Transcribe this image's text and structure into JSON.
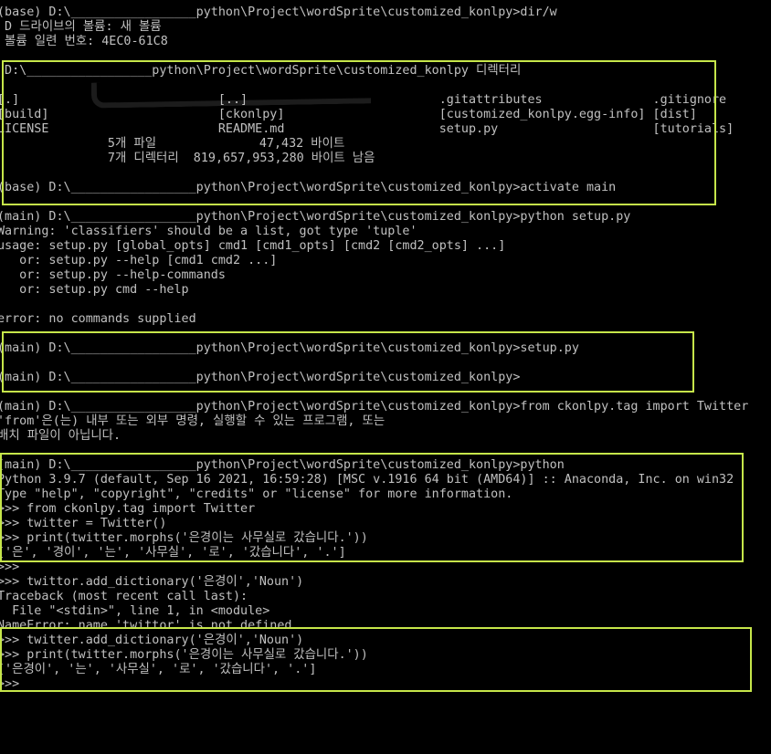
{
  "lines": [
    "(base) D:\\_________________python\\Project\\wordSprite\\customized_konlpy>dir/w",
    " D 드라이브의 볼륨: 새 볼륨",
    " 볼륨 일련 번호: 4EC0-61C8",
    "",
    " D:\\_________________python\\Project\\wordSprite\\customized_konlpy 디렉터리",
    "",
    "[.]                           [..]                          .gitattributes               .gitignore",
    "[build]                       [ckonlpy]                     [customized_konlpy.egg-info] [dist]",
    "LICENSE                       README.md                     setup.py                     [tutorials]",
    "               5개 파일              47,432 바이트",
    "               7개 디렉터리  819,657,953,280 바이트 남음",
    "",
    "(base) D:\\_________________python\\Project\\wordSprite\\customized_konlpy>activate main",
    "",
    "(main) D:\\_________________python\\Project\\wordSprite\\customized_konlpy>python setup.py",
    "Warning: 'classifiers' should be a list, got type 'tuple'",
    "usage: setup.py [global_opts] cmd1 [cmd1_opts] [cmd2 [cmd2_opts] ...]",
    "   or: setup.py --help [cmd1 cmd2 ...]",
    "   or: setup.py --help-commands",
    "   or: setup.py cmd --help",
    "",
    "error: no commands supplied",
    "",
    "(main) D:\\_________________python\\Project\\wordSprite\\customized_konlpy>setup.py",
    "",
    "(main) D:\\_________________python\\Project\\wordSprite\\customized_konlpy>",
    "",
    "(main) D:\\_________________python\\Project\\wordSprite\\customized_konlpy>from ckonlpy.tag import Twitter",
    "'from'은(는) 내부 또는 외부 명령, 실행할 수 있는 프로그램, 또는",
    "배치 파일이 아닙니다.",
    "",
    "(main) D:\\_________________python\\Project\\wordSprite\\customized_konlpy>python",
    "Python 3.9.7 (default, Sep 16 2021, 16:59:28) [MSC v.1916 64 bit (AMD64)] :: Anaconda, Inc. on win32",
    "Type \"help\", \"copyright\", \"credits\" or \"license\" for more information.",
    ">>> from ckonlpy.tag import Twitter",
    ">>> twitter = Twitter()",
    ">>> print(twitter.morphs('은경이는 사무실로 갔습니다.'))",
    "['은', '경이', '는', '사무실', '로', '갔습니다', '.']",
    ">>>",
    ">>> twittor.add_dictionary('은경이','Noun')",
    "Traceback (most recent call last):",
    "  File \"<stdin>\", line 1, in <module>",
    "NameError: name 'twittor' is not defined",
    ">>> twitter.add_dictionary('은경이','Noun')",
    ">>> print(twitter.morphs('은경이는 사무실로 갔습니다.'))",
    "['은경이', '는', '사무실', '로', '갔습니다', '.']",
    ">>>"
  ],
  "colors": {
    "text": "#c0c0c0",
    "background": "#000000",
    "highlight": "#c6e64a"
  }
}
